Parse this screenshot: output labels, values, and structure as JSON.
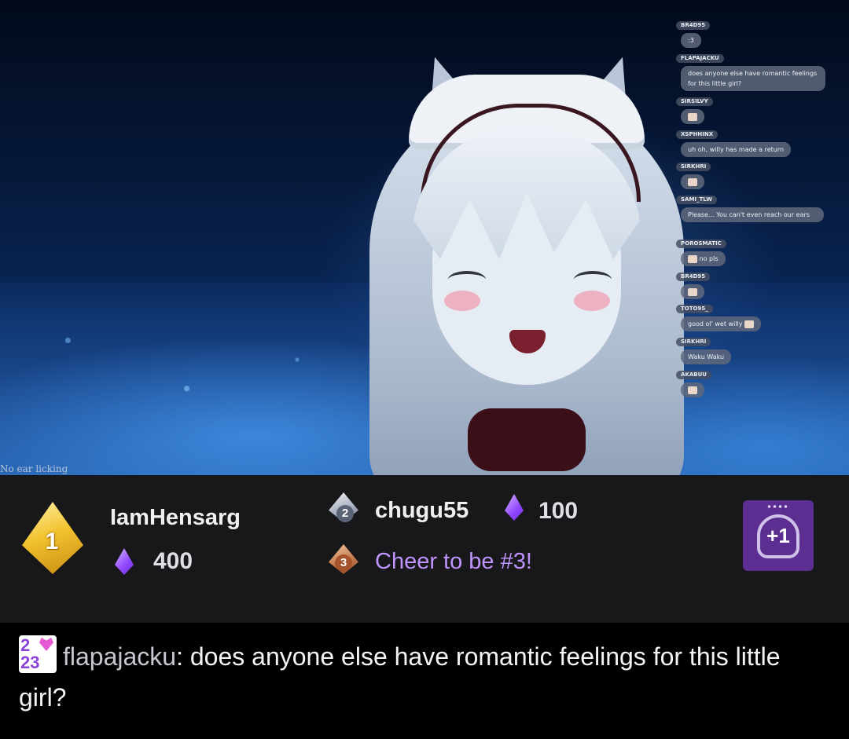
{
  "video": {
    "caption": "No ear licking"
  },
  "overlay_chat": [
    {
      "user": "BR4D95",
      "message": ":3"
    },
    {
      "user": "FLAPAJACKU",
      "message": "does anyone else have romantic feelings for this little girl?"
    },
    {
      "user": "SIRSILVY",
      "message": ""
    },
    {
      "user": "XSPHHINX",
      "message": "uh oh, willy has made a return"
    },
    {
      "user": "SIRKHRI",
      "message": ""
    },
    {
      "user": "SAMI_TLW",
      "message": "Please... You can't even reach our ears"
    },
    {
      "user": "POROSMATIC",
      "message": "no pls"
    },
    {
      "user": "BR4D95",
      "message": ""
    },
    {
      "user": "TOTO95_",
      "message": "good ol' wet willy"
    },
    {
      "user": "SIRKHRI",
      "message": "Waku Waku"
    },
    {
      "user": "AKABUU",
      "message": ""
    }
  ],
  "cheer_leaderboard": {
    "first": {
      "rank": "1",
      "name": "IamHensarg",
      "amount": "400",
      "icon": "gold-rank-gem-icon"
    },
    "second": {
      "rank": "2",
      "name": "chugu55",
      "amount": "100",
      "icon": "silver-rank-gem-icon"
    },
    "third": {
      "rank": "3",
      "cta": "Cheer to be #3!",
      "icon": "bronze-rank-gem-icon"
    },
    "bits_icon": "bits-gem-icon",
    "join_button": {
      "label": "+1",
      "icon": "headphones-plus-one-icon"
    },
    "colors": {
      "background": "#18181b",
      "accent": "#9147ff",
      "cta": "#bf94ff"
    }
  },
  "featured_message": {
    "badge_top": "2",
    "badge_bottom": "23",
    "username": "flapajacku",
    "separator": ":",
    "text": " does anyone else have romantic feelings for this little girl?"
  }
}
